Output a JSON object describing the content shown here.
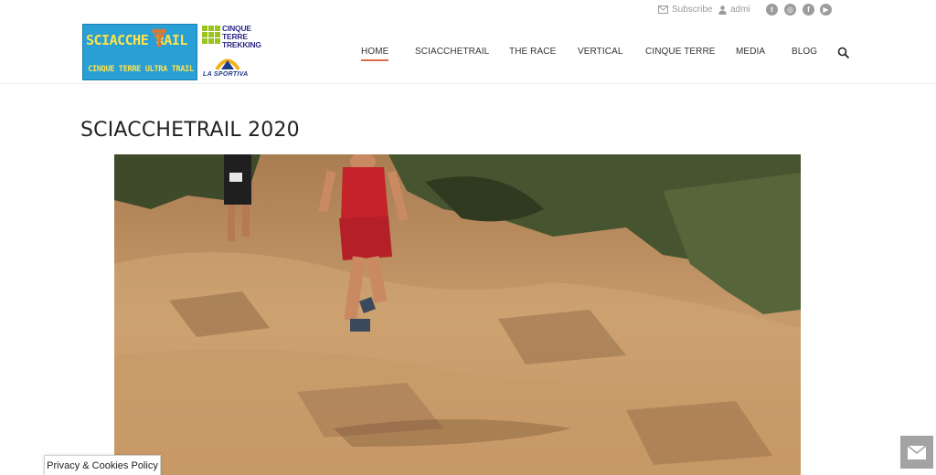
{
  "topbar": {
    "subscribe_label": "Subscribe",
    "user_label": "admi",
    "social": [
      {
        "icon": "twitter-icon",
        "glyph": "t"
      },
      {
        "icon": "instagram-icon",
        "glyph": "◎"
      },
      {
        "icon": "facebook-icon",
        "glyph": "f"
      },
      {
        "icon": "youtube-icon",
        "glyph": "▶"
      }
    ]
  },
  "logo": {
    "title": "SCIACCHE RAIL",
    "subtitle": "CINQUE TERRE ULTRA TRAIL",
    "partner_lines": [
      "CINQUE",
      "TERRE",
      "TREKKING"
    ],
    "sponsor": "LA SPORTIVA"
  },
  "nav": {
    "items": [
      {
        "label": "HOME",
        "active": true
      },
      {
        "label": "SCIACCHETRAIL",
        "active": false
      },
      {
        "label": "THE RACE",
        "active": false
      },
      {
        "label": "VERTICAL",
        "active": false
      },
      {
        "label": "CINQUE TERRE",
        "active": false
      },
      {
        "label": "MEDIA",
        "active": false
      },
      {
        "label": "BLOG",
        "active": false
      }
    ]
  },
  "page": {
    "title": "SCIACCHETRAIL 2020"
  },
  "footer": {
    "cookie_label": "Privacy & Cookies Policy"
  },
  "colors": {
    "accent": "#e06a4c",
    "logo_blue": "#2a9fd6",
    "logo_yellow": "#fbe34a",
    "ct_green": "#9bc31c",
    "ct_blue": "#2d2a87"
  }
}
